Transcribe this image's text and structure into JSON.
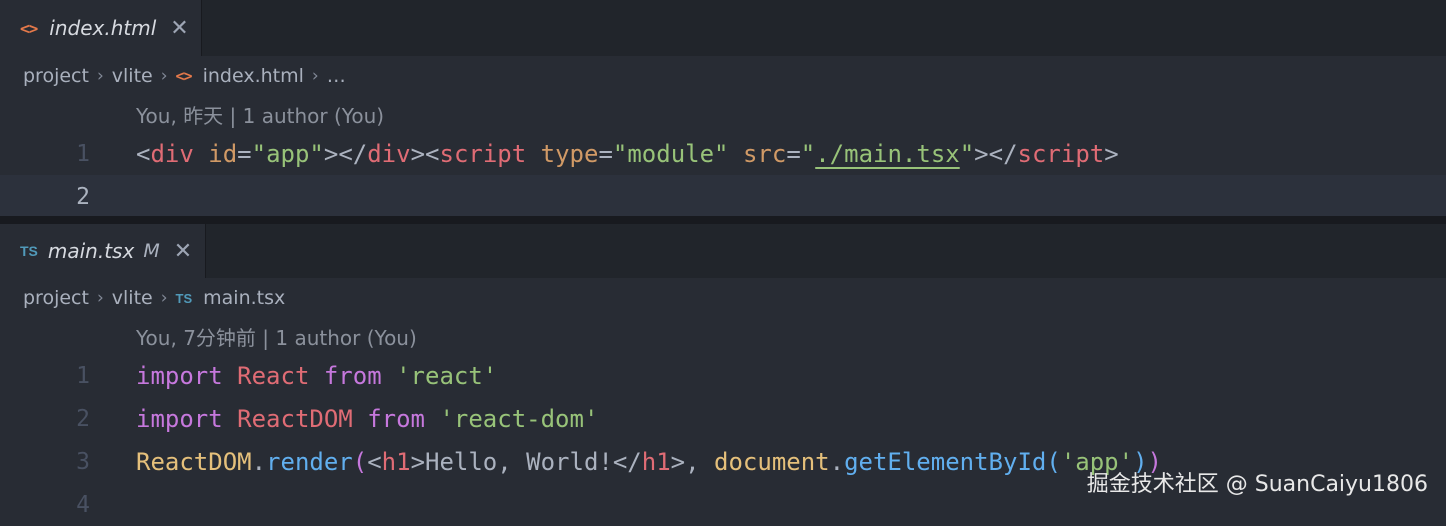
{
  "pane1": {
    "tab": {
      "icon": "<>",
      "label": "index.html",
      "close": "✕"
    },
    "breadcrumb": {
      "items": [
        "project",
        "vlite",
        "index.html",
        "…"
      ],
      "sep": "›",
      "file_icon": "<>"
    },
    "codelens": "You, 昨天 | 1 author (You)",
    "lines": [
      {
        "num": "1",
        "tokens": [
          {
            "t": "<",
            "c": "punc"
          },
          {
            "t": "div",
            "c": "tag"
          },
          {
            "t": " ",
            "c": "punc"
          },
          {
            "t": "id",
            "c": "attr"
          },
          {
            "t": "=",
            "c": "punc"
          },
          {
            "t": "\"app\"",
            "c": "str"
          },
          {
            "t": "></",
            "c": "punc"
          },
          {
            "t": "div",
            "c": "tag"
          },
          {
            "t": "><",
            "c": "punc"
          },
          {
            "t": "script",
            "c": "tag"
          },
          {
            "t": " ",
            "c": "punc"
          },
          {
            "t": "type",
            "c": "attr"
          },
          {
            "t": "=",
            "c": "punc"
          },
          {
            "t": "\"module\"",
            "c": "str"
          },
          {
            "t": " ",
            "c": "punc"
          },
          {
            "t": "src",
            "c": "attr"
          },
          {
            "t": "=",
            "c": "punc"
          },
          {
            "t": "\"",
            "c": "str"
          },
          {
            "t": "./main.tsx",
            "c": "str link"
          },
          {
            "t": "\"",
            "c": "str"
          },
          {
            "t": "></",
            "c": "punc"
          },
          {
            "t": "script",
            "c": "tag"
          },
          {
            "t": ">",
            "c": "punc"
          }
        ]
      },
      {
        "num": "2",
        "tokens": []
      }
    ]
  },
  "pane2": {
    "tab": {
      "icon": "TS",
      "label": "main.tsx",
      "modified": "M",
      "close": "✕"
    },
    "breadcrumb": {
      "items": [
        "project",
        "vlite",
        "main.tsx"
      ],
      "sep": "›",
      "file_icon": "TS"
    },
    "codelens": "You, 7分钟前 | 1 author (You)",
    "lines": [
      {
        "num": "1",
        "tokens": [
          {
            "t": "import",
            "c": "kw"
          },
          {
            "t": " ",
            "c": "punc"
          },
          {
            "t": "React",
            "c": "var"
          },
          {
            "t": " ",
            "c": "punc"
          },
          {
            "t": "from",
            "c": "kw"
          },
          {
            "t": " ",
            "c": "punc"
          },
          {
            "t": "'react'",
            "c": "str"
          }
        ]
      },
      {
        "num": "2",
        "tokens": [
          {
            "t": "import",
            "c": "kw"
          },
          {
            "t": " ",
            "c": "punc"
          },
          {
            "t": "ReactDOM",
            "c": "var"
          },
          {
            "t": " ",
            "c": "punc"
          },
          {
            "t": "from",
            "c": "kw"
          },
          {
            "t": " ",
            "c": "punc"
          },
          {
            "t": "'react-dom'",
            "c": "str"
          }
        ]
      },
      {
        "num": "3",
        "tokens": [
          {
            "t": "ReactDOM",
            "c": "obj"
          },
          {
            "t": ".",
            "c": "punc"
          },
          {
            "t": "render",
            "c": "fn"
          },
          {
            "t": "(",
            "c": "paren"
          },
          {
            "t": "<",
            "c": "punc"
          },
          {
            "t": "h1",
            "c": "tag"
          },
          {
            "t": ">Hello, World!</",
            "c": "punc"
          },
          {
            "t": "h1",
            "c": "tag"
          },
          {
            "t": ">, ",
            "c": "punc"
          },
          {
            "t": "document",
            "c": "obj"
          },
          {
            "t": ".",
            "c": "punc"
          },
          {
            "t": "getElementById",
            "c": "fn"
          },
          {
            "t": "(",
            "c": "fn"
          },
          {
            "t": "'app'",
            "c": "str"
          },
          {
            "t": ")",
            "c": "fn"
          },
          {
            "t": ")",
            "c": "paren"
          }
        ]
      },
      {
        "num": "4",
        "tokens": []
      }
    ]
  },
  "watermark": "掘金技术社区 @ SuanCaiyu1806",
  "colors": {
    "background": "#282c34",
    "tabbar": "#21252b",
    "tag": "#e06c75",
    "attr": "#d19a66",
    "string": "#98c379",
    "keyword": "#c678dd",
    "function": "#61afef",
    "object": "#e5c07b",
    "html_icon": "#e5794a",
    "ts_icon": "#519aba"
  }
}
